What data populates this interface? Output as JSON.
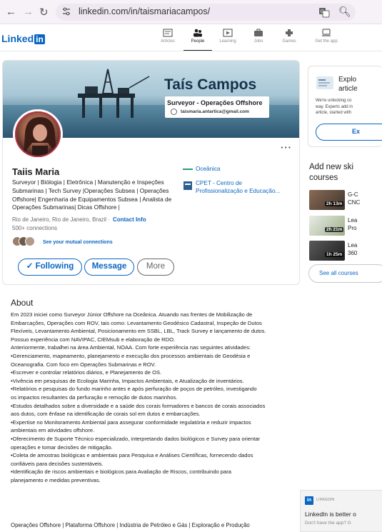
{
  "browser": {
    "url": "linkedin.com/in/taismariacampos/",
    "back_icon": "arrow-left-icon",
    "forward_icon": "arrow-right-icon",
    "reload_icon": "reload-icon"
  },
  "header": {
    "logo_text": "Linked",
    "logo_in": "in",
    "nav": [
      {
        "label": "Articles",
        "icon": "articles-icon"
      },
      {
        "label": "People",
        "icon": "people-icon",
        "active": true
      },
      {
        "label": "Learning",
        "icon": "learning-icon"
      },
      {
        "label": "Jobs",
        "icon": "jobs-icon"
      },
      {
        "label": "Games",
        "icon": "games-icon"
      },
      {
        "label": "Get the app",
        "icon": "app-icon"
      }
    ]
  },
  "banner": {
    "title": "Taís Campos",
    "subtitle": "Surveyor - Operações Offshore",
    "email": "taismaria.antartica@gmail.com"
  },
  "profile": {
    "name": "Taiis Maria",
    "headline_lines": [
      "Surveyor | Biólogia | Eletrônica | Manutenção e Inspeções",
      "Submarinas | Tech Survey |Operações Subsea | Operações",
      "Offshore| Engenharia de Equipamentos Subsea | Analista de",
      "Operações Submarinas| Dicas Offshore |"
    ],
    "location": "Rio de Janeiro, Rio de Janeiro, Brazil ·",
    "contact_info": "Contact Info",
    "connections": "500+ connections",
    "mutual": "See your mutual connections",
    "org1": "Oceânica",
    "org2_line1": "CPET - Centro de",
    "org2_line2": "Profissionalização e Educação...",
    "following_label": "Following",
    "message_label": "Message",
    "more_label": "More",
    "check_mark": "✓",
    "more_dots": "···"
  },
  "about": {
    "title": "About",
    "lines": [
      "Em 2023 iniciei como Surveyor Júnior Offshore na Oceânica. Atuando nas frentes de Mobilização de",
      "Embarcações, Operações com ROV, tais como: Levantamento Geodésico Cadastral, Inspeção de Dutos",
      "Flexíveis, Levantamento Ambiental, Posicionamento em SSBL, LBL, Track Survey e lançamento de dutos.",
      "Possuo experiência com NAVIPAC, CIEMsub e elaboração de RDO.",
      "Anteriormente, trabalhei na área Ambiental, NOAA. Com forte experiência nas seguintes atividades:",
      "•Gerenciamento, mapeamento, planejamento e execução dos processos ambientais de Geodésia e",
      "Oceanografia. Com foco em Operações Submarinas e ROV.",
      "•Escrever e controlar relatórios diários, e Planejamento de OS.",
      "•Vivência em pesquisas de Ecologia Marinha, Impactos Ambientais, e Atualização de inventários.",
      "•Relatórios e pesquisas do fundo marinho antes e após perfuração de poços de petróleo, investigando",
      "os impactos resultantes da perfuração e remoção de dutos marinhos.",
      "•Estudos detalhados sobre a diversidade e a saúde dos corais formadores e bancos de corais associados",
      "aos dutos, com ênfase na identificação de corais sol em dutos e embarcações.",
      "•Expertise no Monitoramento Ambiental para assegurar conformidade regulatória e reduzir impactos",
      "ambientais em atividades offshore.",
      "•Oferecimento de Suporte Técnico especializado, interpretando dados biológicos e Survey para orientar",
      "operações e tomar decisões de mitigação.",
      "•Coleta de amostras biológicas e ambientais para Pesquisa e Análises Científicas, fornecendo dados",
      "confiáveis para decisões sustentáveis.",
      "•Identificação de riscos ambientais e biológicos para Avaliação de Riscos, contribuindo para",
      "planejamento e medidas preventivas."
    ],
    "footer": "Operações Offshore | Plataforma Offshore | Indústria de Petróleo e Gás | Exploração e Produção"
  },
  "sidebar": {
    "card_title_1": "Explo",
    "card_title_2": "article",
    "card_text": [
      "We're unlocking co",
      "way. Experts add in",
      "article, started with"
    ],
    "card_button": "Ex",
    "courses_title_1": "Add new ski",
    "courses_title_2": "courses",
    "courses": [
      {
        "duration": "2h 13m",
        "title_1": "G-C",
        "title_2": "CNC"
      },
      {
        "duration": "2h 21m",
        "title_1": "Lea",
        "title_2": "Pro"
      },
      {
        "duration": "1h 25m",
        "title_1": "Lea",
        "title_2": "360"
      }
    ],
    "see_all": "See all courses"
  },
  "promo": {
    "logo": "in",
    "brand": "LINKEDIN",
    "title": "LinkedIn is better o",
    "subtitle": "Don't have the app? G"
  },
  "colors": {
    "brand_blue": "#0a66c2",
    "avatar_ring": "#b63246"
  }
}
